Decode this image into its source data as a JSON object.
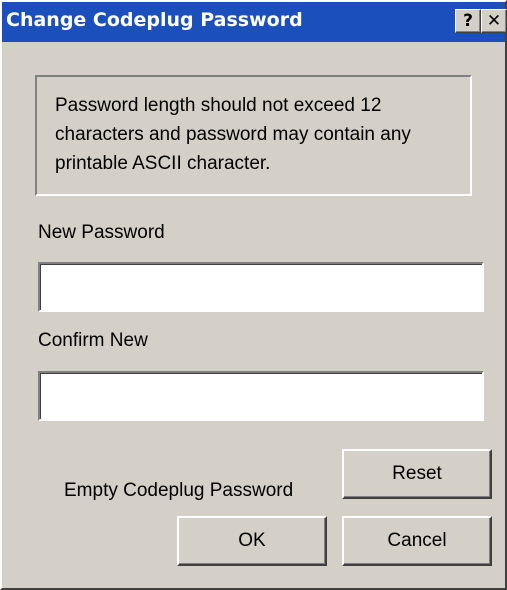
{
  "window": {
    "title": "Change Codeplug Password",
    "help_glyph": "?",
    "close_glyph": "✕",
    "titlebar_color": "#1b4fbc",
    "face_color": "#d4d0c8"
  },
  "info": {
    "text": "Password length should not exceed 12 characters and password may contain any printable ASCII character."
  },
  "fields": {
    "new_password_label": "New Password",
    "new_password_value": "",
    "confirm_new_label": "Confirm New",
    "confirm_new_value": ""
  },
  "empty": {
    "label": "Empty Codeplug Password"
  },
  "buttons": {
    "reset": "Reset",
    "ok": "OK",
    "cancel": "Cancel"
  }
}
